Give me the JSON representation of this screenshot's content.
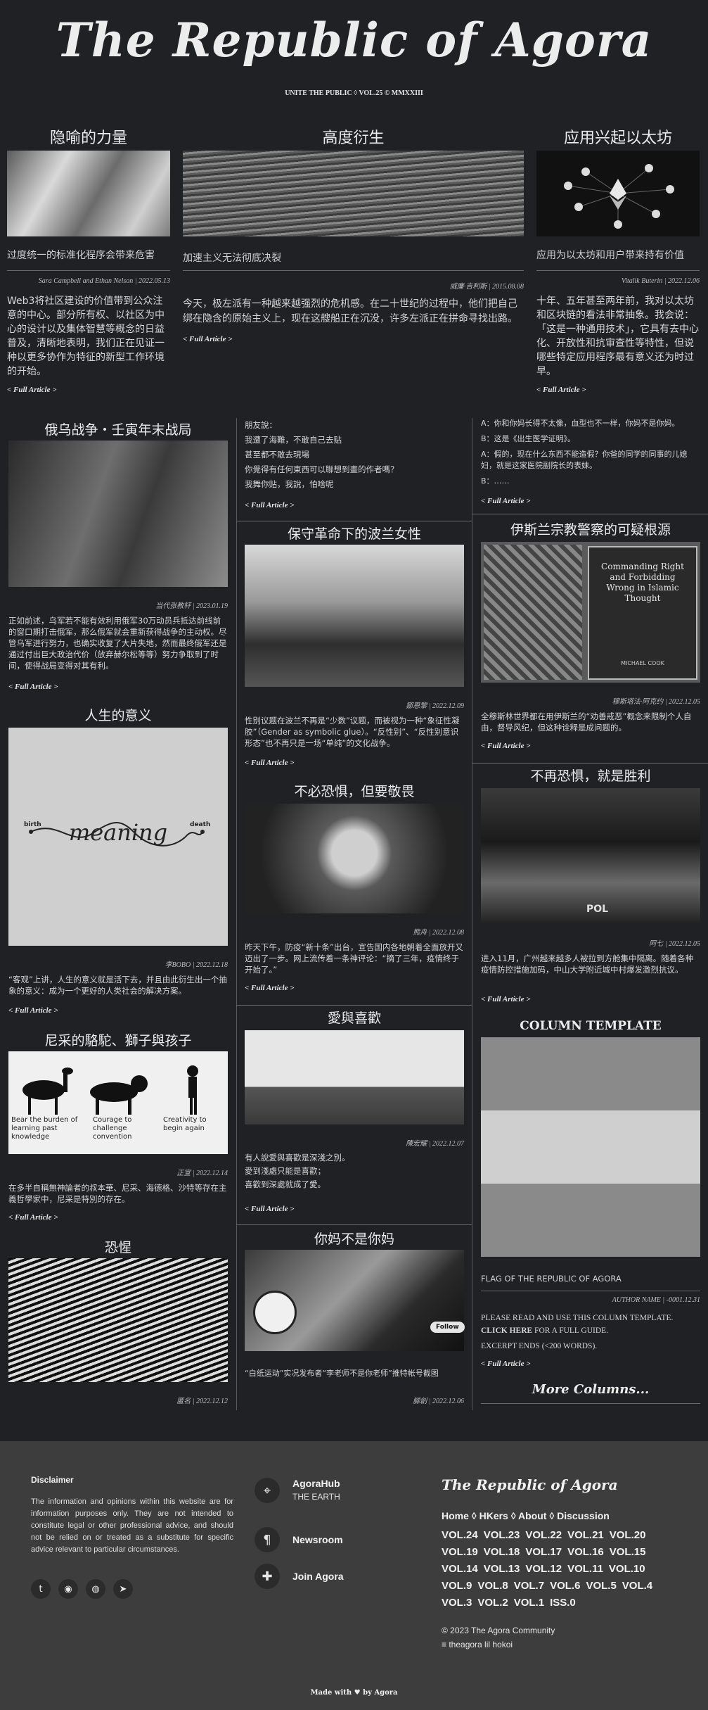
{
  "masthead": {
    "title": "The Republic of Agora",
    "subtitle": "UNITE THE PUBLIC ◊ VOL.25 © MMXXIII"
  },
  "top": [
    {
      "head": "隐喻的力量",
      "caption": "过度统一的标准化程序会带来危害",
      "meta": "Sara Campbell and Ethan Nelson | 2022.05.13",
      "body": "Web3将社区建设的价值带到公众注意的中心。部分所有权、以社区为中心的设计以及集体智慧等概念的日益普及，清晰地表明，我们正在见证一种以更多协作为特征的新型工作环境的开始。",
      "full": "< Full Article >"
    },
    {
      "head": "高度衍生",
      "caption": "加速主义无法彻底决裂",
      "meta": "威廉·吉利斯 | 2015.08.08",
      "body": "今天，极左派有一种越来越强烈的危机感。在二十世纪的过程中，他们把自己绑在隐含的原始主义上，现在这艘船正在沉没，许多左派正在拼命寻找出路。",
      "full": "< Full Article >"
    },
    {
      "head": "应用兴起以太坊",
      "caption": "应用为以太坊和用户带来持有价值",
      "meta": "Vitalik Buterin | 2022.12.06",
      "body": "十年、五年甚至两年前，我对以太坊和区块链的看法非常抽象。我会说：「这是一种通用技术」，它具有去中心化、开放性和抗审查性等特性，但说哪些特定应用程序最有意义还为时过早。",
      "full": "< Full Article >"
    }
  ],
  "col1": [
    {
      "head": "俄乌战争・壬寅年末战局",
      "meta": "当代张教轩 | 2023.01.19",
      "body": "正如前述，乌军若不能有效利用俄军30万动员兵抵达前线前的窗口期打击俄军，那么俄军就会重新获得战争的主动权。尽管乌军进行努力，也确实收复了大片失地，然而最终俄军还是通过付出巨大政治代价（放弃赫尔松等等）努力争取到了时间，使得战局变得对其有利。",
      "full": "< Full Article >"
    },
    {
      "head": "人生的意义",
      "meta": "李BOBO | 2022.12.18",
      "body": "“客观”上讲，人生的意义就是活下去，并且由此衍生出一个抽象的意义：成为一个更好的人类社会的解决方案。",
      "full": "< Full Article >",
      "fig_birth": "birth",
      "fig_death": "death",
      "fig_word": "meaning"
    },
    {
      "head": "尼采的駱駝、獅子與孩子",
      "meta": "正宣 | 2022.12.14",
      "body": "在多半自稱無神論者的叔本華、尼采、海德格、沙特等存在主義哲學家中，尼采是特別的存在。",
      "full": "< Full Article >",
      "fig": [
        "Bear the burden of learning past knowledge",
        "Courage to challenge convention",
        "Creativity to begin again"
      ]
    },
    {
      "head": "恐惺",
      "meta": "匿名 | 2022.12.12"
    }
  ],
  "col2": [
    {
      "lines": [
        "朋友說：",
        "我遭了海難，不敢自己去贴",
        "甚至都不敢去現場",
        "你覺得有任何東西可以聯想到畫的作者嗎？",
        "我舞你贴，我說，怕啥呢"
      ],
      "full": "< Full Article >"
    },
    {
      "head": "保守革命下的波兰女性",
      "meta": "鄒恩黎 | 2022.12.09",
      "body": "性别议题在波兰不再是“少数”议题，而被视为一种“象征性凝胶”（Gender as symbolic glue）。“反性别”、“反性别意识形态”也不再只是一场“单纯”的文化战争。",
      "full": "< Full Article >"
    },
    {
      "head": "不必恐惧，但要敬畏",
      "meta": "熊舟 | 2022.12.08",
      "body": "昨天下午，防疫“新十条”出台，宣告国内各地朝着全面放开又迈出了一步。网上流传着一条神评论：“摘了三年，疫情终于开始了。”",
      "full": "< Full Article >"
    },
    {
      "head": "愛與喜歡",
      "meta": "陳宏耀 | 2022.12.07",
      "lines": [
        "有人說愛與喜歡是深淺之別。",
        "愛到淺處只能是喜歡；",
        "喜歡到深處就成了愛。"
      ],
      "full": "< Full Article >"
    },
    {
      "head": "你妈不是你妈",
      "meta": "腳創 | 2022.12.06",
      "body": "“白纸运动”实况发布者“李老师不是你老师”推特帐号截图",
      "follow": "Follow"
    }
  ],
  "col3": [
    {
      "lines": [
        "A：你和你妈长得不太像，血型也不一样，你妈不是你妈。",
        "B：这是《出生医学证明》。",
        "A：假的，现在什么东西不能造假？你爸的同学的同事的儿媳妇，就是这家医院副院长的表妹。",
        "B：……"
      ],
      "full": "< Full Article >"
    },
    {
      "head": "伊斯兰宗教警察的可疑根源",
      "meta": "穆斯塔法·阿克约 | 2022.12.05",
      "body": "全穆斯林世界都在用伊斯兰的“劝善戒恶”概念来限制个人自由，督导风纪，但这种诠释是成问题的。",
      "full": "< Full Article >",
      "book_title": "Commanding Right and Forbidding Wrong in Islamic Thought",
      "book_author": "MICHAEL COOK"
    },
    {
      "head": "不再恐惧，就是胜利",
      "meta": "阿七 | 2022.12.05",
      "body": "进入11月，广州越来越多人被拉到方舱集中隔离。随着各种疫情防控措施加码，中山大学附近城中村爆发激烈抗议。",
      "full": "< Full Article >",
      "sign": "POL"
    },
    {
      "head": "COLUMN TEMPLATE",
      "caption": "FLAG OF THE REPUBLIC OF AGORA",
      "meta": "AUTHOR NAME | -0001.12.31",
      "body1": "PLEASE READ AND USE THIS COLUMN TEMPLATE.",
      "body2": "CLICK HERE",
      "body3": " FOR A FULL GUIDE.",
      "body4": "EXCERPT ENDS (<200 WORDS).",
      "full": "< Full Article >",
      "more": "More Columns..."
    }
  ],
  "footer": {
    "disclaimer_title": "Disclaimer",
    "disclaimer_text": "The information and opinions within this website are for information purposes only. They are not intended to constitute legal or other professional advice, and should not be relied on or treated as a substitute for specific advice relevant to particular circumstances.",
    "links": [
      {
        "title": "AgoraHub",
        "sub": "THE EARTH"
      },
      {
        "title": "Newsroom",
        "sub": ""
      },
      {
        "title": "Join Agora",
        "sub": ""
      }
    ],
    "brand": "The Republic of Agora",
    "nav": "Home ◊ HKers ◊ About ◊ Discussion",
    "vols": [
      "VOL.24",
      "VOL.23",
      "VOL.22",
      "VOL.21",
      "VOL.20",
      "VOL.19",
      "VOL.18",
      "VOL.17",
      "VOL.16",
      "VOL.15",
      "VOL.14",
      "VOL.13",
      "VOL.12",
      "VOL.11",
      "VOL.10",
      "VOL.9",
      "VOL.8",
      "VOL.7",
      "VOL.6",
      "VOL.5",
      "VOL.4",
      "VOL.3",
      "VOL.2",
      "VOL.1",
      "ISS.0"
    ],
    "copyright": "© 2023 The Agora Community",
    "motto": "≡ theagora lil hokoi",
    "made": "Made with ♥ by Agora"
  }
}
